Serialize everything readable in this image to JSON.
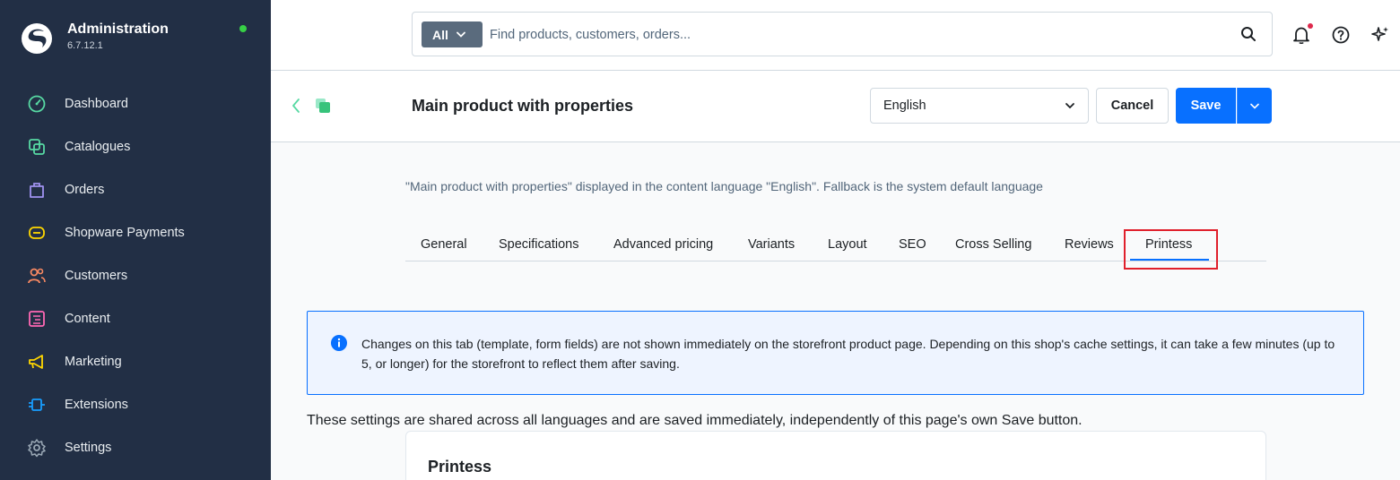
{
  "sidebar": {
    "title": "Administration",
    "version": "6.7.12.1",
    "items": [
      {
        "label": "Dashboard",
        "icon": "dashboard-icon",
        "color": "#57d9a3"
      },
      {
        "label": "Catalogues",
        "icon": "catalogue-icon",
        "color": "#57d9a3"
      },
      {
        "label": "Orders",
        "icon": "orders-icon",
        "color": "#a092f0"
      },
      {
        "label": "Shopware Payments",
        "icon": "payments-icon",
        "color": "#ffd700"
      },
      {
        "label": "Customers",
        "icon": "customers-icon",
        "color": "#f88962"
      },
      {
        "label": "Content",
        "icon": "content-icon",
        "color": "#ff68b4"
      },
      {
        "label": "Marketing",
        "icon": "marketing-icon",
        "color": "#ffd700"
      },
      {
        "label": "Extensions",
        "icon": "extensions-icon",
        "color": "#189eff"
      },
      {
        "label": "Settings",
        "icon": "settings-icon",
        "color": "#9aa8b5"
      }
    ]
  },
  "search": {
    "filter_label": "All",
    "placeholder": "Find products, customers, orders..."
  },
  "header": {
    "title": "Main product with properties",
    "language": "English",
    "cancel_label": "Cancel",
    "save_label": "Save"
  },
  "content": {
    "language_info": "\"Main product with properties\" displayed in the content language \"English\". Fallback is the system default language",
    "tabs": [
      "General",
      "Specifications",
      "Advanced pricing",
      "Variants",
      "Layout",
      "SEO",
      "Cross Selling",
      "Reviews",
      "Printess"
    ],
    "active_tab": "Printess",
    "alert_text": "Changes on this tab (template, form fields) are not shown immediately on the storefront product page. Depending on this shop's cache settings, it can take a few minutes (up to 5, or longer) for the storefront to reflect them after saving.",
    "shared_note": "These settings are shared across all languages and are saved immediately, independently of this page's own Save button.",
    "card_title": "Printess"
  },
  "colors": {
    "sidebar_bg": "#222f45",
    "accent": "#0870ff",
    "status_online": "#37d046",
    "highlight": "#e0202c"
  }
}
